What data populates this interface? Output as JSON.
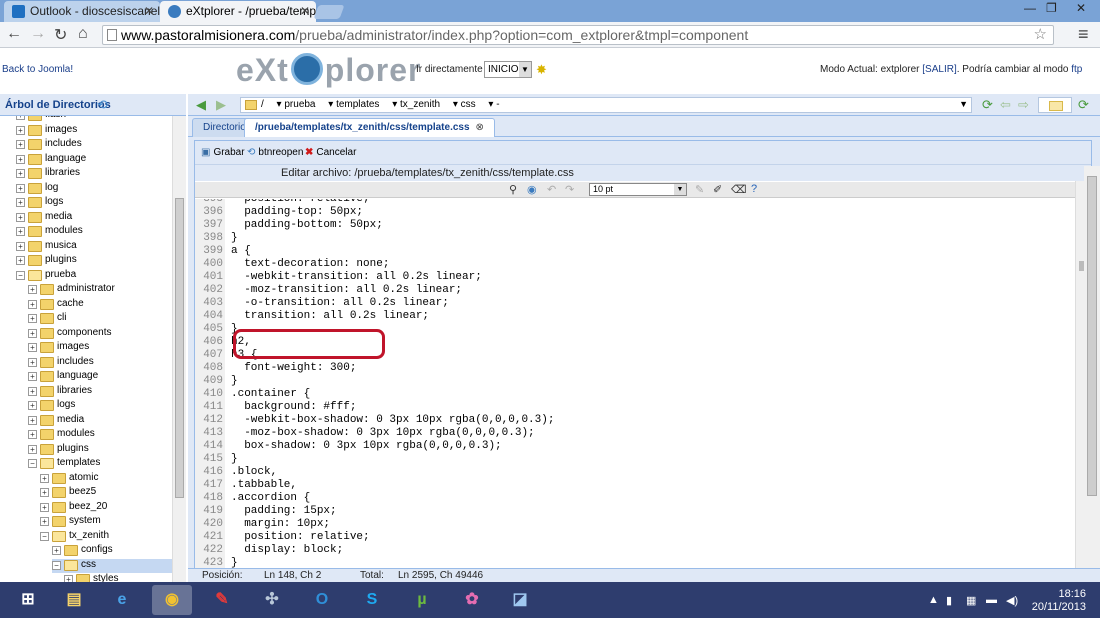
{
  "browser": {
    "tabs": [
      {
        "title": "Outlook - dioscesiscanelo",
        "active": false
      },
      {
        "title": "eXtplorer - /prueba/templ",
        "active": true
      }
    ],
    "url_host": "www.pastoralmisionera.com",
    "url_path": "/prueba/administrator/index.php?option=com_extplorer&tmpl=component"
  },
  "header": {
    "back_link": "Back to Joomla!",
    "logo_left": "eXt",
    "logo_right": "plorer",
    "goto_label": "Ir directamente a:",
    "goto_value": "INICIO",
    "mode_prefix": "Modo Actual: extplorer",
    "mode_exit": "[SALIR]",
    "mode_change": ". Podría cambiar al modo",
    "mode_ftp": "ftp"
  },
  "tree": {
    "title": "Árbol de Directorios",
    "items": [
      {
        "label": "flash",
        "level": 1,
        "open": false
      },
      {
        "label": "images",
        "level": 1,
        "open": false
      },
      {
        "label": "includes",
        "level": 1,
        "open": false
      },
      {
        "label": "language",
        "level": 1,
        "open": false
      },
      {
        "label": "libraries",
        "level": 1,
        "open": false
      },
      {
        "label": "log",
        "level": 1,
        "open": false
      },
      {
        "label": "logs",
        "level": 1,
        "open": false
      },
      {
        "label": "media",
        "level": 1,
        "open": false
      },
      {
        "label": "modules",
        "level": 1,
        "open": false
      },
      {
        "label": "musica",
        "level": 1,
        "open": false
      },
      {
        "label": "plugins",
        "level": 1,
        "open": false
      },
      {
        "label": "prueba",
        "level": 1,
        "open": true
      },
      {
        "label": "administrator",
        "level": 2,
        "open": false
      },
      {
        "label": "cache",
        "level": 2,
        "open": false
      },
      {
        "label": "cli",
        "level": 2,
        "open": false
      },
      {
        "label": "components",
        "level": 2,
        "open": false
      },
      {
        "label": "images",
        "level": 2,
        "open": false
      },
      {
        "label": "includes",
        "level": 2,
        "open": false
      },
      {
        "label": "language",
        "level": 2,
        "open": false
      },
      {
        "label": "libraries",
        "level": 2,
        "open": false
      },
      {
        "label": "logs",
        "level": 2,
        "open": false
      },
      {
        "label": "media",
        "level": 2,
        "open": false
      },
      {
        "label": "modules",
        "level": 2,
        "open": false
      },
      {
        "label": "plugins",
        "level": 2,
        "open": false
      },
      {
        "label": "templates",
        "level": 2,
        "open": true
      },
      {
        "label": "atomic",
        "level": 3,
        "open": false
      },
      {
        "label": "beez5",
        "level": 3,
        "open": false
      },
      {
        "label": "beez_20",
        "level": 3,
        "open": false
      },
      {
        "label": "system",
        "level": 3,
        "open": false
      },
      {
        "label": "tx_zenith",
        "level": 3,
        "open": true
      },
      {
        "label": "configs",
        "level": 4,
        "open": false
      },
      {
        "label": "css",
        "level": 4,
        "open": true,
        "selected": true
      },
      {
        "label": "styles",
        "level": 5,
        "open": false
      }
    ]
  },
  "pathbar": {
    "segments": [
      "/",
      "prueba",
      "templates",
      "tx_zenith",
      "css"
    ]
  },
  "tabs": {
    "dir_label": "Directorio",
    "file_label": "/prueba/templates/tx_zenith/css/template.css"
  },
  "editor": {
    "save_label": "Grabar",
    "reopen_label": "btnreopen",
    "cancel_label": "Cancelar",
    "title": "Editar archivo: /prueba/templates/tx_zenith/css/template.css",
    "font_size": "10 pt",
    "lines": [
      {
        "n": "395",
        "text": "  position: relative;"
      },
      {
        "n": "396",
        "text": "  padding-top: 50px;"
      },
      {
        "n": "397",
        "text": "  padding-bottom: 50px;"
      },
      {
        "n": "398",
        "text": "}"
      },
      {
        "n": "399",
        "text": "a {"
      },
      {
        "n": "400",
        "text": "  text-decoration: none;"
      },
      {
        "n": "401",
        "text": "  -webkit-transition: all 0.2s linear;"
      },
      {
        "n": "402",
        "text": "  -moz-transition: all 0.2s linear;"
      },
      {
        "n": "403",
        "text": "  -o-transition: all 0.2s linear;"
      },
      {
        "n": "404",
        "text": "  transition: all 0.2s linear;"
      },
      {
        "n": "405",
        "text": "}"
      },
      {
        "n": "406",
        "text": "h2,"
      },
      {
        "n": "407",
        "text": "h3 {"
      },
      {
        "n": "408",
        "text": "  font-weight: 300;"
      },
      {
        "n": "409",
        "text": "}"
      },
      {
        "n": "410",
        "text": ".container {"
      },
      {
        "n": "411",
        "text": "  background: #fff;"
      },
      {
        "n": "412",
        "text": "  -webkit-box-shadow: 0 3px 10px rgba(0,0,0,0.3);"
      },
      {
        "n": "413",
        "text": "  -moz-box-shadow: 0 3px 10px rgba(0,0,0,0.3);"
      },
      {
        "n": "414",
        "text": "  box-shadow: 0 3px 10px rgba(0,0,0,0.3);"
      },
      {
        "n": "415",
        "text": "}"
      },
      {
        "n": "416",
        "text": ".block,"
      },
      {
        "n": "417",
        "text": ".tabbable,"
      },
      {
        "n": "418",
        "text": ".accordion {"
      },
      {
        "n": "419",
        "text": "  padding: 15px;"
      },
      {
        "n": "420",
        "text": "  margin: 10px;"
      },
      {
        "n": "421",
        "text": "  position: relative;"
      },
      {
        "n": "422",
        "text": "  display: block;"
      },
      {
        "n": "423",
        "text": "}"
      }
    ]
  },
  "status": {
    "position_label": "Posición:",
    "position_value": "Ln 148, Ch 2",
    "total_label": "Total:",
    "total_value": "Ln 2595, Ch 49446"
  },
  "taskbar": {
    "time": "18:16",
    "date": "20/11/2013"
  },
  "colors": {
    "highlight_border": "#c0142a",
    "panel_bg": "#dfe8f6",
    "taskbar_bg": "#2e3d6e"
  }
}
